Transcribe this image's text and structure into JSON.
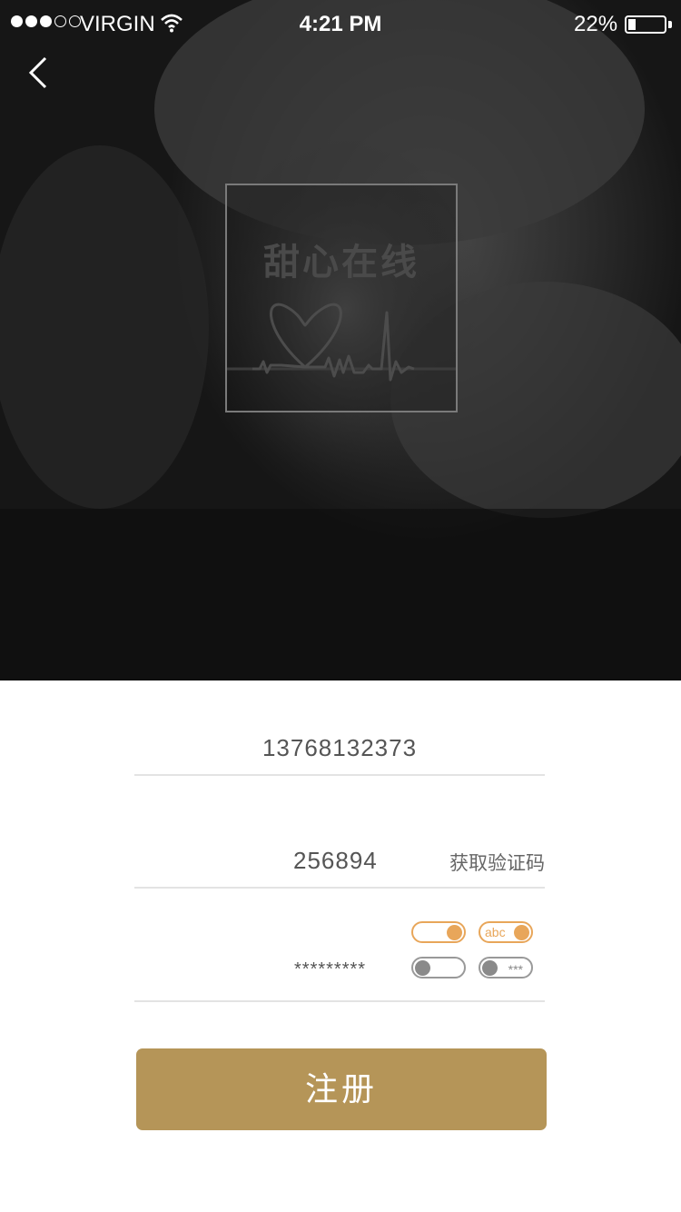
{
  "status_bar": {
    "carrier": "VIRGIN",
    "time": "4:21 PM",
    "battery_percent": "22%",
    "battery_level": 0.22,
    "signal_bars_filled": 3,
    "signal_bars_total": 5
  },
  "nav": {
    "back_icon": "chevron-left-icon"
  },
  "logo": {
    "text": "甜心在线",
    "icon": "heart-pulse-icon"
  },
  "form": {
    "phone_value": "13768132373",
    "code_value": "256894",
    "get_code_label": "获取验证码",
    "password_value": "*********",
    "toggle_abc_label": "abc",
    "toggle_mask_label": "***",
    "register_label": "注册"
  },
  "colors": {
    "accent": "#e8a65a",
    "button": "#b59558"
  }
}
